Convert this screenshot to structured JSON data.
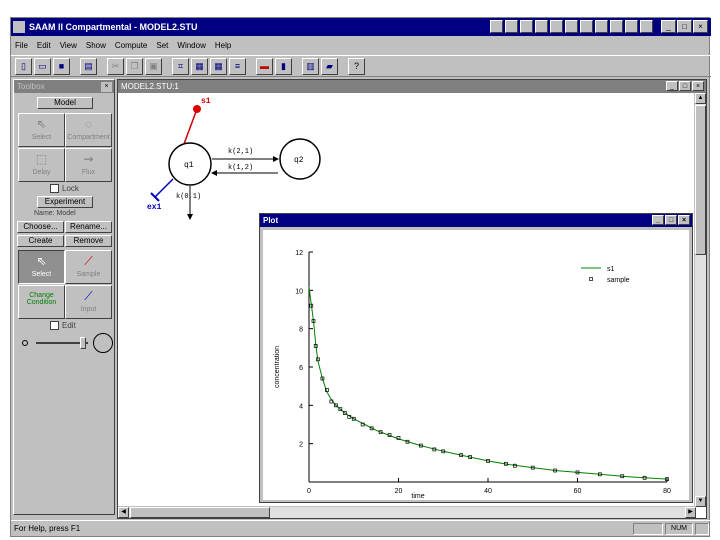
{
  "app": {
    "title": "SAAM II Compartmental - MODEL2.STU"
  },
  "menu": [
    "File",
    "Edit",
    "View",
    "Show",
    "Compute",
    "Set",
    "Window",
    "Help"
  ],
  "toolbox": {
    "title": "Toolbox",
    "model_button": "Model",
    "tools": {
      "select": "Select",
      "compartment": "Compartment",
      "delay": "Delay",
      "flux": "Flux",
      "sample": "Sample",
      "input": "Input",
      "change_condition": "Change Condition",
      "select2": "Select"
    },
    "lock_label": "Lock",
    "experiment_button": "Experiment",
    "name_label": "Name: Model",
    "choose_button": "Choose...",
    "rename_button": "Rename...",
    "create_button": "Create",
    "remove_button": "Remove",
    "edit_label": "Edit"
  },
  "model_window": {
    "title": "MODEL2.STU:1",
    "nodes": {
      "q1": "q1",
      "q2": "q2",
      "s1": "s1",
      "ex1": "ex1"
    },
    "labels": {
      "k21": "k(2,1)",
      "k12": "k(1,2)",
      "k01": "k(0,1)"
    }
  },
  "plot_window": {
    "title": "Plot"
  },
  "chart_data": {
    "type": "line",
    "xlabel": "time",
    "ylabel": "concentration",
    "xlim": [
      0,
      80
    ],
    "ylim": [
      0,
      12
    ],
    "x_ticks": [
      "0",
      "20",
      "40",
      "60",
      "80"
    ],
    "y_ticks": [
      "2",
      "4",
      "6",
      "8",
      "10",
      "12"
    ],
    "legend_position": "top-right",
    "series": [
      {
        "name": "s1",
        "style": "line",
        "color": "#008000",
        "x": [
          0,
          0.5,
          1,
          1.5,
          2,
          3,
          4,
          5,
          6,
          8,
          10,
          12,
          15,
          20,
          25,
          30,
          35,
          40,
          45,
          50,
          55,
          60,
          65,
          70,
          75,
          80
        ],
        "y": [
          10.2,
          9.3,
          8.4,
          7.2,
          6.3,
          5.4,
          4.7,
          4.3,
          4.0,
          3.6,
          3.3,
          3.05,
          2.7,
          2.25,
          1.9,
          1.6,
          1.35,
          1.1,
          0.9,
          0.75,
          0.6,
          0.5,
          0.4,
          0.3,
          0.22,
          0.15
        ]
      },
      {
        "name": "sample",
        "style": "points",
        "color": "#000000",
        "x": [
          0.5,
          1,
          1.5,
          2,
          3,
          4,
          5,
          6,
          7,
          8,
          9,
          10,
          12,
          14,
          16,
          18,
          20,
          22,
          25,
          28,
          30,
          34,
          36,
          40,
          44,
          46,
          50,
          55,
          60,
          65,
          70,
          75,
          80
        ],
        "y": [
          9.2,
          8.4,
          7.1,
          6.4,
          5.4,
          4.8,
          4.2,
          4.0,
          3.8,
          3.6,
          3.4,
          3.3,
          3.0,
          2.8,
          2.6,
          2.45,
          2.3,
          2.1,
          1.9,
          1.7,
          1.6,
          1.4,
          1.3,
          1.1,
          0.95,
          0.85,
          0.75,
          0.6,
          0.5,
          0.4,
          0.3,
          0.22,
          0.15
        ]
      }
    ]
  },
  "status": {
    "help_text": "For Help, press F1",
    "num": "NUM"
  }
}
